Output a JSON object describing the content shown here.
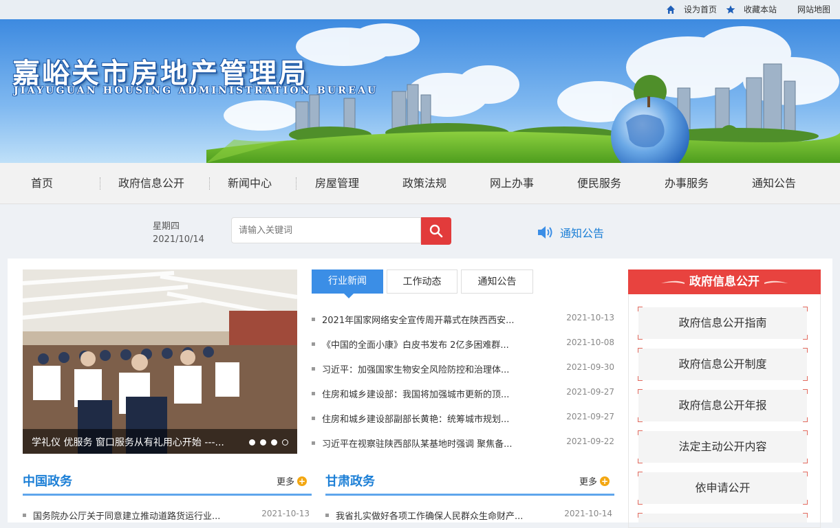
{
  "colors": {
    "accent_blue": "#3b8ee6",
    "accent_red": "#e8433f",
    "link_blue": "#1c7fd6"
  },
  "topbar": {
    "set_home": "设为首页",
    "favorite": "收藏本站",
    "sitemap": "网站地图",
    "icons": [
      "home-icon",
      "star-icon"
    ]
  },
  "banner": {
    "title": "嘉峪关市房地产管理局",
    "subtitle": "JIAYUGUAN HOUSING ADMINISTRATION BUREAU"
  },
  "nav": {
    "items": [
      "首页",
      "政府信息公开",
      "新闻中心",
      "房屋管理",
      "政策法规",
      "网上办事",
      "便民服务",
      "办事服务",
      "通知公告"
    ]
  },
  "toolbar": {
    "weekday": "星期四",
    "date": "2021/10/14",
    "search_placeholder": "请输入关键词",
    "notice_label": "通知公告"
  },
  "slider": {
    "caption": "学礼仪 优服务 窗口服务从有礼用心开始 ---...",
    "slide_count": 4,
    "active_index": 3
  },
  "news": {
    "tabs": [
      "行业新闻",
      "工作动态",
      "通知公告"
    ],
    "active_tab": 0,
    "items": [
      {
        "title": "2021年国家网络安全宣传周开幕式在陕西西安...",
        "date": "2021-10-13"
      },
      {
        "title": "《中国的全面小康》白皮书发布 2亿多困难群...",
        "date": "2021-10-08"
      },
      {
        "title": "习近平：加强国家生物安全风险防控和治理体...",
        "date": "2021-09-30"
      },
      {
        "title": "住房和城乡建设部：我国将加强城市更新的顶...",
        "date": "2021-09-27"
      },
      {
        "title": "住房和城乡建设部副部长黄艳：统筹城市规划...",
        "date": "2021-09-27"
      },
      {
        "title": "习近平在视察驻陕西部队某基地时强调 聚焦备...",
        "date": "2021-09-22"
      }
    ]
  },
  "china_gov": {
    "title": "中国政务",
    "more": "更多",
    "items": [
      {
        "title": "国务院办公厅关于同意建立推动道路货运行业...",
        "date": "2021-10-13"
      }
    ]
  },
  "gansu_gov": {
    "title": "甘肃政务",
    "more": "更多",
    "items": [
      {
        "title": "我省扎实做好各项工作确保人民群众生命财产...",
        "date": "2021-10-14"
      }
    ]
  },
  "gov_info": {
    "title": "政府信息公开",
    "items": [
      "政府信息公开指南",
      "政府信息公开制度",
      "政府信息公开年报",
      "法定主动公开内容",
      "依申请公开"
    ]
  }
}
